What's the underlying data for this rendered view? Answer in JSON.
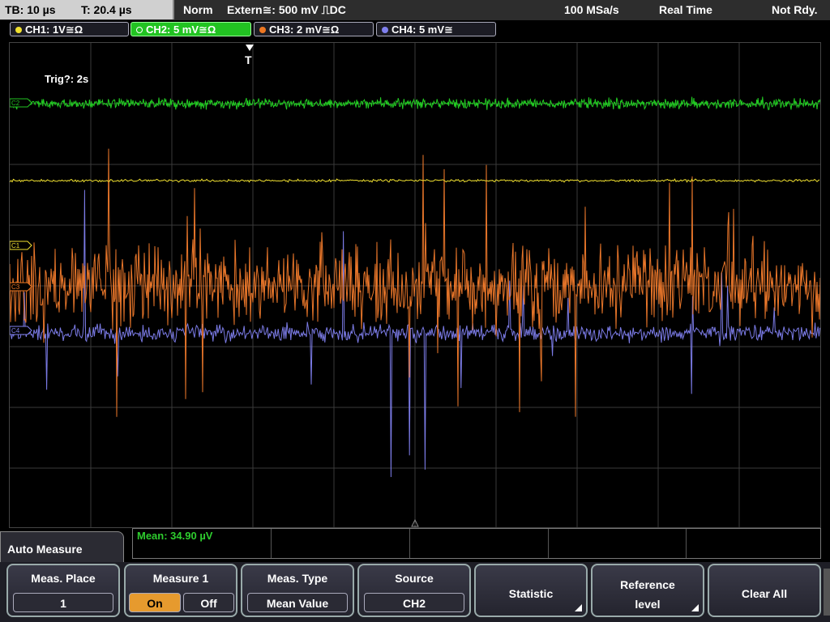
{
  "topbar": {
    "timebase": "TB: 10 µs",
    "trigger_time": "T: 20.4 µs",
    "mode": "Norm",
    "trigger_source": "Extern≅: 500 mV ⎍DC",
    "sample_rate": "100 MSa/s",
    "acq_mode": "Real Time",
    "status": "Not Rdy."
  },
  "channels": [
    {
      "label": "CH1: 1V≅Ω",
      "color": "#f0e030",
      "active": false
    },
    {
      "label": "CH2: 5 mV≅Ω",
      "color": "#22c322",
      "active": true
    },
    {
      "label": "CH3: 2 mV≅Ω",
      "color": "#ee7722",
      "active": false
    },
    {
      "label": "CH4: 5 mV≅",
      "color": "#8080ee",
      "active": false
    }
  ],
  "screen": {
    "trigger_marker": "T",
    "trigger_status": "Trig?: 2s",
    "channel_markers": [
      "C2",
      "C1",
      "C3",
      "C4"
    ]
  },
  "measurement": {
    "mean_text": "Mean: 34.90 µV"
  },
  "menu": {
    "title": "Auto Measure",
    "softkeys": {
      "meas_place": {
        "title": "Meas. Place",
        "value": "1"
      },
      "measure1": {
        "title": "Measure 1",
        "on": "On",
        "off": "Off"
      },
      "meas_type": {
        "title": "Meas. Type",
        "value": "Mean Value"
      },
      "source": {
        "title": "Source",
        "value": "CH2"
      },
      "statistic": {
        "title": "Statistic"
      },
      "reference": {
        "title_line1": "Reference",
        "title_line2": "level"
      },
      "clear_all": {
        "title": "Clear All"
      }
    }
  }
}
